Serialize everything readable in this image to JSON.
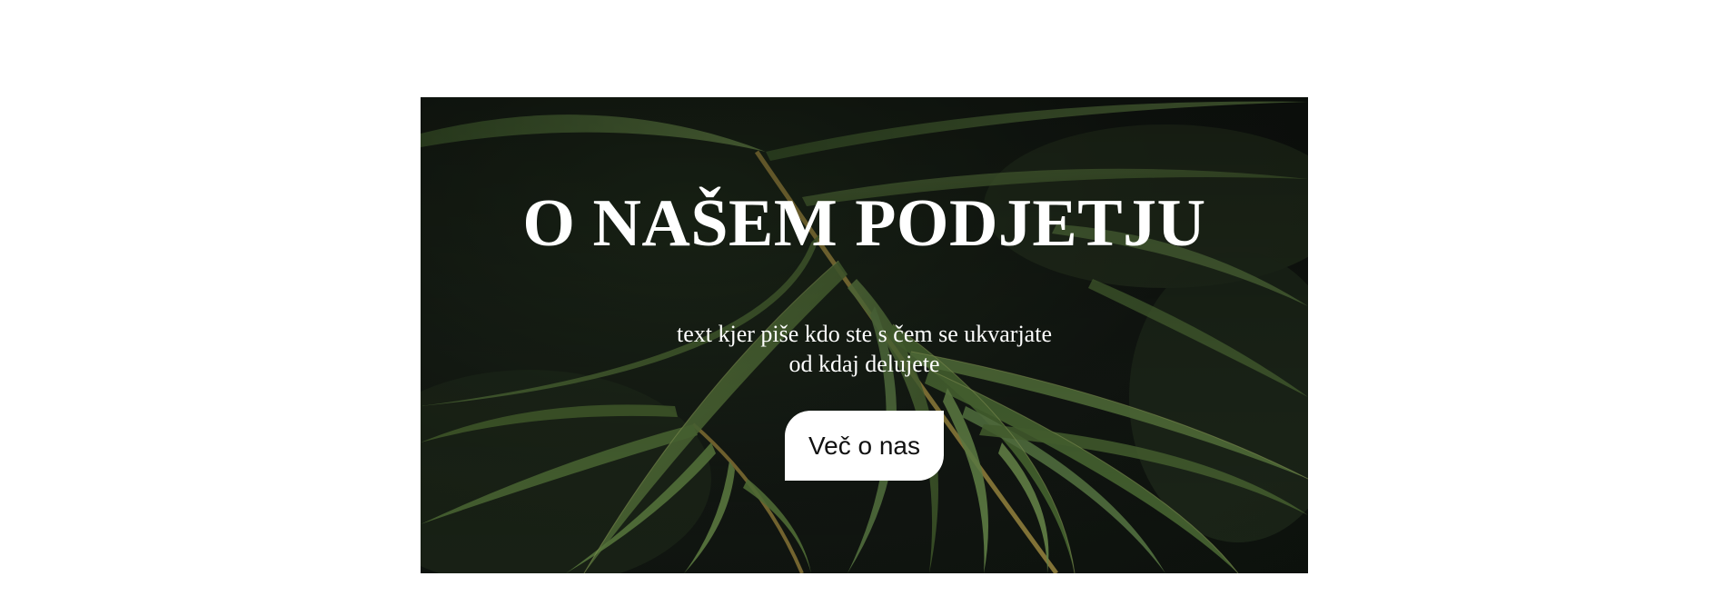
{
  "hero": {
    "title": "O NAŠEM PODJETJU",
    "text_line1": "text kjer piše kdo ste s čem se ukvarjate",
    "text_line2": "od kdaj delujete",
    "button_label": "Več o nas",
    "background_image": "palm-leaves-image"
  },
  "colors": {
    "background": "#ffffff",
    "hero_text": "#ffffff",
    "button_bg": "#ffffff",
    "button_text": "#111111",
    "leaf_green": "#4e6a35"
  }
}
